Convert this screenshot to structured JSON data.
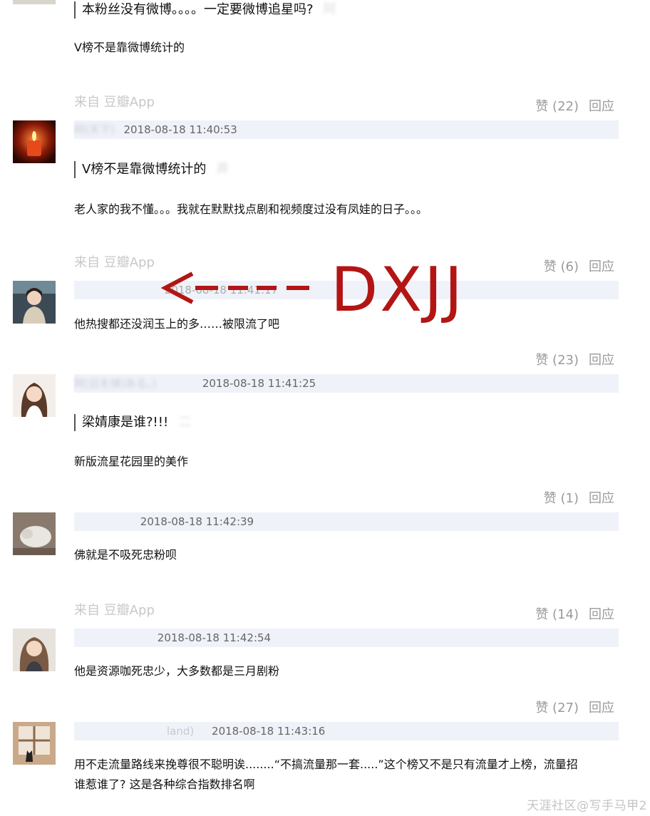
{
  "top": {
    "quote_text": "本粉丝没有微博。。。。一定要微博追星吗?",
    "quote_tail": "阿",
    "reply_text": "V榜不是靠微博统计的"
  },
  "comments": [
    {
      "source": "来自 豆瓣App",
      "likes": "赞 (22)",
      "reply": "回应",
      "user": "阿(天下)",
      "time": "2018-08-18 11:40:53",
      "quote_text": "V榜不是靠微博统计的",
      "quote_tail": "弄",
      "text": "老人家的我不懂。。。我就在默默找点剧和视频度过没有凤娃的日子。。。"
    },
    {
      "source": "来自 豆瓣App",
      "likes": "赞 (6)",
      "reply": "回应",
      "user": "",
      "time": "2018-08-18 11:41:17",
      "text": "他热搜都还没润玉上的多……被限流了吧"
    },
    {
      "likes": "赞 (23)",
      "reply": "回应",
      "user": "阿(日を挟)ある。)",
      "time": "2018-08-18 11:41:25",
      "quote_text": "梁婧康是谁?!!!",
      "quote_tail": "二",
      "text": "新版流星花园里的美作"
    },
    {
      "likes": "赞 (1)",
      "reply": "回应",
      "user": "",
      "time": "2018-08-18 11:42:39",
      "text": "佛就是不吸死忠粉呗"
    },
    {
      "source": "来自 豆瓣App",
      "likes": "赞 (14)",
      "reply": "回应",
      "user": "",
      "time": "2018-08-18 11:42:54",
      "text": "他是资源咖死忠少，大多数都是三月剧粉"
    },
    {
      "likes": "赞 (27)",
      "reply": "回应",
      "user": "land)",
      "time": "2018-08-18 11:43:16",
      "text_line1": "用不走流量路线来挽尊很不聪明诶........“不搞流量那一套.....”这个榜又不是只有流量才上榜，流量招",
      "text_line2": "谁惹谁了? 这是各种综合指数排名啊"
    }
  ],
  "annotation": {
    "label": "DXJJ",
    "color": "#b31515"
  },
  "watermark": "天涯社区@写手马甲2"
}
